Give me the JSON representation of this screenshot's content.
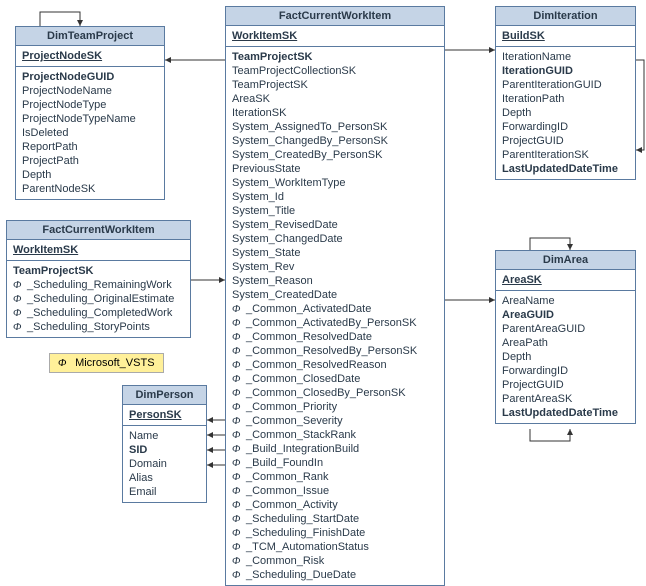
{
  "phi": "Φ",
  "legend": {
    "text": "Microsoft_VSTS"
  },
  "entities": {
    "dimTeamProject": {
      "title": "DimTeamProject",
      "pk": "ProjectNodeSK",
      "fields": [
        {
          "label": "ProjectNodeGUID",
          "bold": true
        },
        {
          "label": "ProjectNodeName"
        },
        {
          "label": "ProjectNodeType"
        },
        {
          "label": "ProjectNodeTypeName"
        },
        {
          "label": "IsDeleted"
        },
        {
          "label": "ReportPath"
        },
        {
          "label": "ProjectPath"
        },
        {
          "label": "Depth"
        },
        {
          "label": "ParentNodeSK"
        }
      ]
    },
    "factCurrentWI_small": {
      "title": "FactCurrentWorkItem",
      "pk": "WorkItemSK",
      "fields": [
        {
          "label": "TeamProjectSK",
          "bold": true
        },
        {
          "label": "_Scheduling_RemainingWork",
          "phi": true
        },
        {
          "label": "_Scheduling_OriginalEstimate",
          "phi": true
        },
        {
          "label": "_Scheduling_CompletedWork",
          "phi": true
        },
        {
          "label": "_Scheduling_StoryPoints",
          "phi": true
        }
      ]
    },
    "dimPerson": {
      "title": "DimPerson",
      "pk": "PersonSK",
      "fields": [
        {
          "label": "Name"
        },
        {
          "label": "SID",
          "bold": true
        },
        {
          "label": "Domain"
        },
        {
          "label": "Alias"
        },
        {
          "label": "Email"
        }
      ]
    },
    "factCurrentWI_large": {
      "title": "FactCurrentWorkItem",
      "pk": "WorkItemSK",
      "fields": [
        {
          "label": "TeamProjectSK",
          "bold": true
        },
        {
          "label": "TeamProjectCollectionSK"
        },
        {
          "label": "TeamProjectSK"
        },
        {
          "label": "AreaSK"
        },
        {
          "label": "IterationSK"
        },
        {
          "label": "System_AssignedTo_PersonSK"
        },
        {
          "label": "System_ChangedBy_PersonSK"
        },
        {
          "label": "System_CreatedBy_PersonSK"
        },
        {
          "label": "PreviousState"
        },
        {
          "label": "System_WorkItemType"
        },
        {
          "label": "System_Id"
        },
        {
          "label": "System_Title"
        },
        {
          "label": "System_RevisedDate"
        },
        {
          "label": "System_ChangedDate"
        },
        {
          "label": "System_State"
        },
        {
          "label": "System_Rev"
        },
        {
          "label": "System_Reason"
        },
        {
          "label": "System_CreatedDate"
        },
        {
          "label": "_Common_ActivatedDate",
          "phi": true
        },
        {
          "label": "_Common_ActivatedBy_PersonSK",
          "phi": true
        },
        {
          "label": "_Common_ResolvedDate",
          "phi": true
        },
        {
          "label": "_Common_ResolvedBy_PersonSK",
          "phi": true
        },
        {
          "label": "_Common_ResolvedReason",
          "phi": true
        },
        {
          "label": "_Common_ClosedDate",
          "phi": true
        },
        {
          "label": "_Common_ClosedBy_PersonSK",
          "phi": true
        },
        {
          "label": "_Common_Priority",
          "phi": true
        },
        {
          "label": "_Common_Severity",
          "phi": true
        },
        {
          "label": "_Common_StackRank",
          "phi": true
        },
        {
          "label": "_Build_IntegrationBuild",
          "phi": true
        },
        {
          "label": "_Build_FoundIn",
          "phi": true
        },
        {
          "label": "_Common_Rank",
          "phi": true
        },
        {
          "label": "_Common_Issue",
          "phi": true
        },
        {
          "label": "_Common_Activity",
          "phi": true
        },
        {
          "label": "_Scheduling_StartDate",
          "phi": true
        },
        {
          "label": "_Scheduling_FinishDate",
          "phi": true
        },
        {
          "label": "_TCM_AutomationStatus",
          "phi": true
        },
        {
          "label": "_Common_Risk",
          "phi": true
        },
        {
          "label": "_Scheduling_DueDate",
          "phi": true
        }
      ]
    },
    "dimIteration": {
      "title": "DimIteration",
      "pk": "BuildSK",
      "fields": [
        {
          "label": "IterationName"
        },
        {
          "label": "IterationGUID",
          "bold": true
        },
        {
          "label": "ParentIterationGUID"
        },
        {
          "label": "IterationPath"
        },
        {
          "label": "Depth"
        },
        {
          "label": "ForwardingID"
        },
        {
          "label": "ProjectGUID"
        },
        {
          "label": "ParentIterationSK"
        },
        {
          "label": "LastUpdatedDateTime",
          "bold": true
        }
      ]
    },
    "dimArea": {
      "title": "DimArea",
      "pk": "AreaSK",
      "fields": [
        {
          "label": "AreaName"
        },
        {
          "label": "AreaGUID",
          "bold": true
        },
        {
          "label": "ParentAreaGUID"
        },
        {
          "label": "AreaPath"
        },
        {
          "label": "Depth"
        },
        {
          "label": "ForwardingID"
        },
        {
          "label": "ProjectGUID"
        },
        {
          "label": "ParentAreaSK"
        },
        {
          "label": "LastUpdatedDateTime",
          "bold": true
        }
      ]
    }
  }
}
